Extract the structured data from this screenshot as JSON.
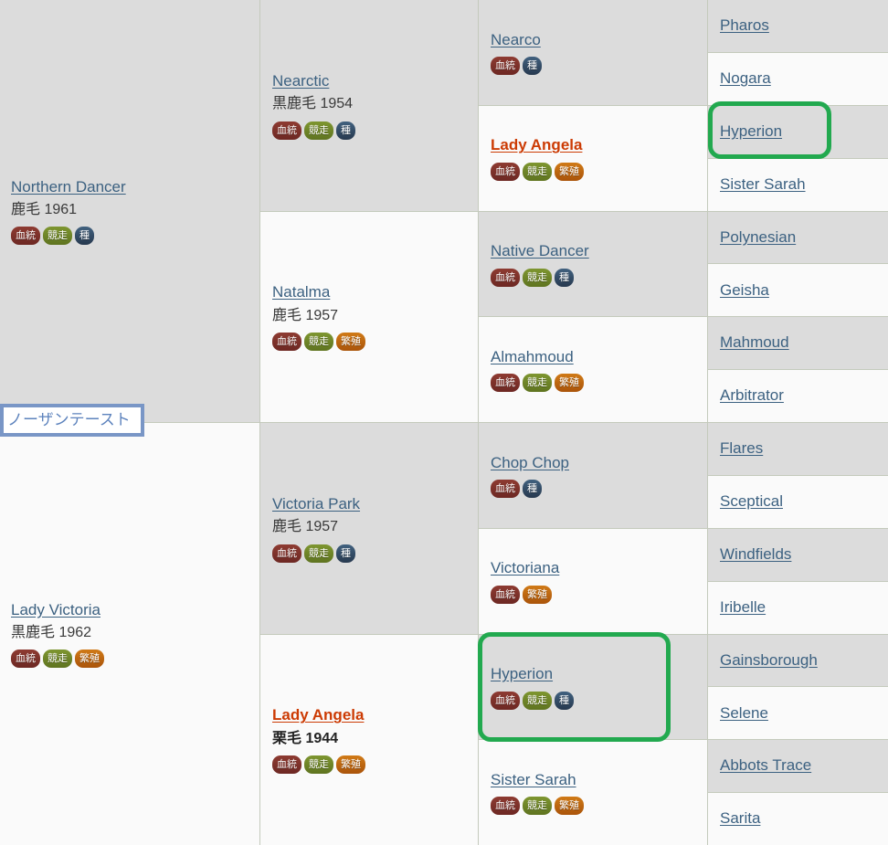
{
  "badges": {
    "ketto": {
      "label": "血統",
      "color": "#7d322b",
      "name": "pedigree-badge"
    },
    "kyoso": {
      "label": "競走",
      "color": "#6e8528",
      "name": "racing-badge"
    },
    "tane": {
      "label": "種",
      "color": "#34506a",
      "name": "stallion-badge"
    },
    "hanshoku": {
      "label": "繁殖",
      "color": "#bd6410",
      "name": "broodmare-badge"
    }
  },
  "colors": {
    "link": "#3c6181",
    "accent": "#cc3b04",
    "highlight_ring": "#22a94f",
    "tooltip_border": "#7996c6",
    "tooltip_text": "#5d83bd",
    "cell_shade": "#dcdcdc",
    "cell_plain": "#fafafa",
    "grid_line": "#c4cabc"
  },
  "tooltip": {
    "label": "ノーザンテースト"
  },
  "generations": {
    "gen1": [
      {
        "name": "Northern Dancer",
        "meta": "鹿毛 1961",
        "shade": true,
        "accent": false,
        "badges": [
          "ketto",
          "kyoso",
          "tane"
        ]
      },
      {
        "name": "Lady Victoria",
        "meta": "黒鹿毛 1962",
        "shade": false,
        "accent": false,
        "badges": [
          "ketto",
          "kyoso",
          "hanshoku"
        ]
      }
    ],
    "gen2": [
      {
        "name": "Nearctic",
        "meta": "黒鹿毛 1954",
        "shade": true,
        "accent": false,
        "badges": [
          "ketto",
          "kyoso",
          "tane"
        ]
      },
      {
        "name": "Natalma",
        "meta": "鹿毛 1957",
        "shade": false,
        "accent": false,
        "badges": [
          "ketto",
          "kyoso",
          "hanshoku"
        ]
      },
      {
        "name": "Victoria Park",
        "meta": "鹿毛 1957",
        "shade": true,
        "accent": false,
        "badges": [
          "ketto",
          "kyoso",
          "tane"
        ]
      },
      {
        "name": "Lady Angela",
        "meta": "栗毛 1944",
        "shade": false,
        "accent": true,
        "badges": [
          "ketto",
          "kyoso",
          "hanshoku"
        ]
      }
    ],
    "gen3": [
      {
        "name": "Nearco",
        "shade": true,
        "accent": false,
        "badges": [
          "ketto",
          "tane"
        ]
      },
      {
        "name": "Lady Angela",
        "shade": false,
        "accent": true,
        "badges": [
          "ketto",
          "kyoso",
          "hanshoku"
        ]
      },
      {
        "name": "Native Dancer",
        "shade": true,
        "accent": false,
        "badges": [
          "ketto",
          "kyoso",
          "tane"
        ]
      },
      {
        "name": "Almahmoud",
        "shade": false,
        "accent": false,
        "badges": [
          "ketto",
          "kyoso",
          "hanshoku"
        ]
      },
      {
        "name": "Chop Chop",
        "shade": true,
        "accent": false,
        "badges": [
          "ketto",
          "tane"
        ]
      },
      {
        "name": "Victoriana",
        "shade": false,
        "accent": false,
        "badges": [
          "ketto",
          "hanshoku"
        ]
      },
      {
        "name": "Hyperion",
        "shade": true,
        "accent": false,
        "badges": [
          "ketto",
          "kyoso",
          "tane"
        ],
        "highlight": true
      },
      {
        "name": "Sister Sarah",
        "shade": false,
        "accent": false,
        "badges": [
          "ketto",
          "kyoso",
          "hanshoku"
        ]
      }
    ],
    "gen4": [
      {
        "name": "Pharos",
        "shade": true,
        "highlight": false
      },
      {
        "name": "Nogara",
        "shade": false,
        "highlight": false
      },
      {
        "name": "Hyperion",
        "shade": true,
        "highlight": true
      },
      {
        "name": "Sister Sarah",
        "shade": false,
        "highlight": false
      },
      {
        "name": "Polynesian",
        "shade": true,
        "highlight": false
      },
      {
        "name": "Geisha",
        "shade": false,
        "highlight": false
      },
      {
        "name": "Mahmoud",
        "shade": true,
        "highlight": false
      },
      {
        "name": "Arbitrator",
        "shade": false,
        "highlight": false
      },
      {
        "name": "Flares",
        "shade": true,
        "highlight": false
      },
      {
        "name": "Sceptical",
        "shade": false,
        "highlight": false
      },
      {
        "name": "Windfields",
        "shade": true,
        "highlight": false
      },
      {
        "name": "Iribelle",
        "shade": false,
        "highlight": false
      },
      {
        "name": "Gainsborough",
        "shade": true,
        "highlight": false
      },
      {
        "name": "Selene",
        "shade": false,
        "highlight": false
      },
      {
        "name": "Abbots Trace",
        "shade": true,
        "highlight": false
      },
      {
        "name": "Sarita",
        "shade": false,
        "highlight": false
      }
    ]
  }
}
